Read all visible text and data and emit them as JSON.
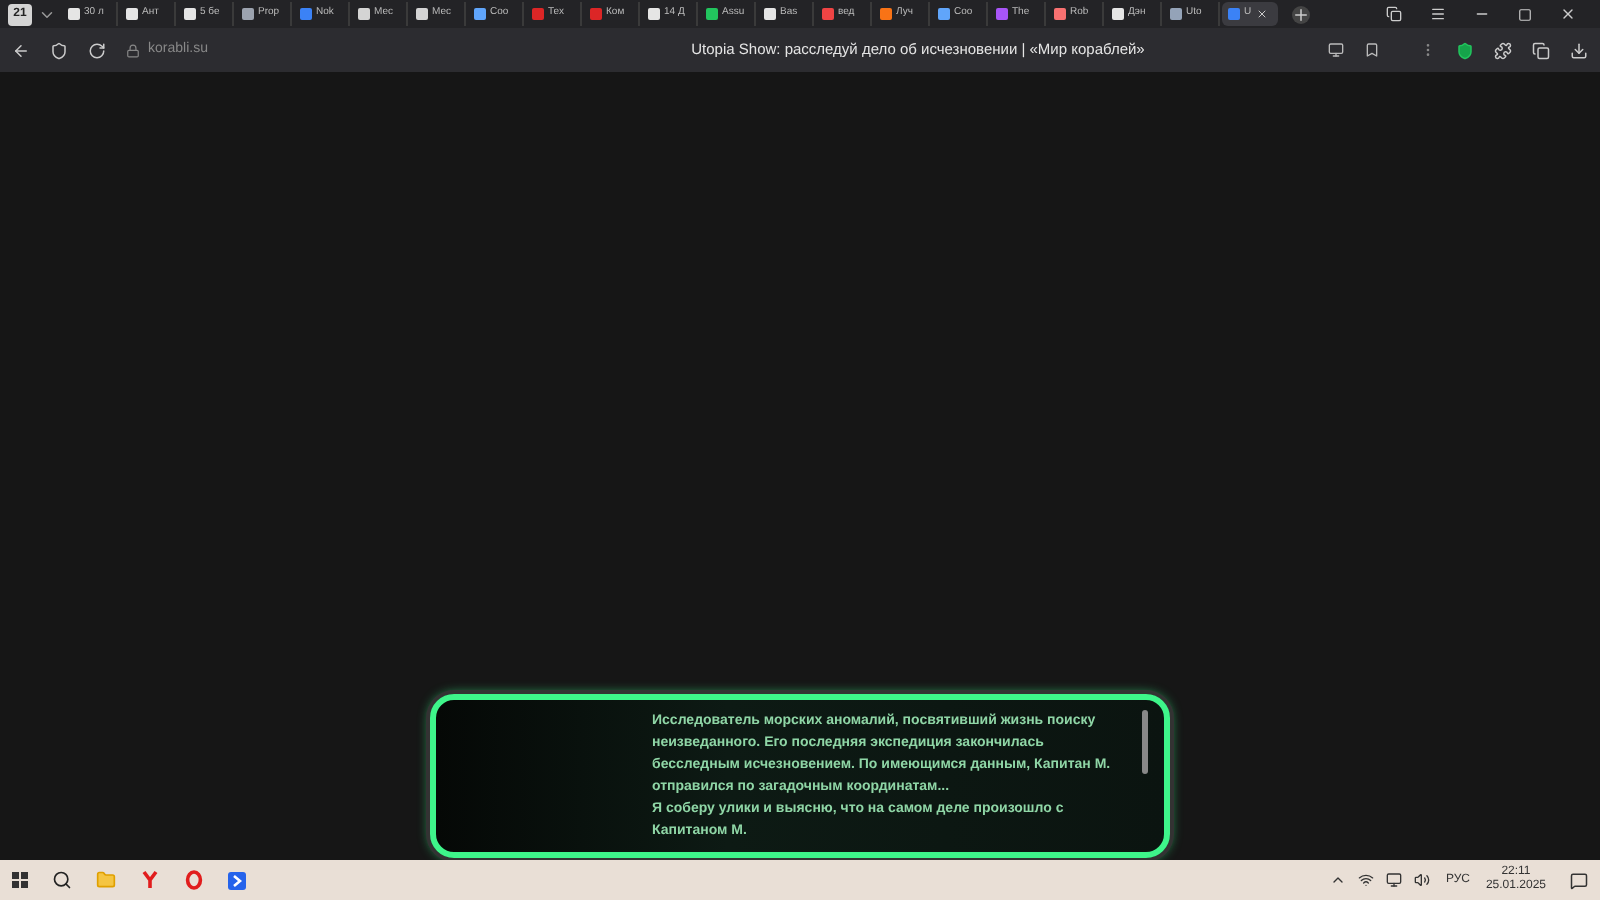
{
  "browser": {
    "profile_badge": "21",
    "tabs": [
      {
        "label": "30 л",
        "selected": false,
        "color": "#e5e5e5"
      },
      {
        "label": "Ант",
        "selected": false,
        "color": "#e5e5e5"
      },
      {
        "label": "5 бе",
        "selected": false,
        "color": "#e5e5e5"
      },
      {
        "label": "Prop",
        "selected": false,
        "color": "#9ca3af"
      },
      {
        "label": "Nok",
        "selected": false,
        "color": "#3b82f6"
      },
      {
        "label": "Мес",
        "selected": false,
        "color": "#d4d4d4"
      },
      {
        "label": "Мес",
        "selected": false,
        "color": "#d4d4d4"
      },
      {
        "label": "Coo",
        "selected": false,
        "color": "#60a5fa"
      },
      {
        "label": "Тех",
        "selected": false,
        "color": "#dc2626"
      },
      {
        "label": "Ком",
        "selected": false,
        "color": "#dc2626"
      },
      {
        "label": "14 Д",
        "selected": false,
        "color": "#e5e5e5"
      },
      {
        "label": "Assu",
        "selected": false,
        "color": "#22c55e"
      },
      {
        "label": "Bas",
        "selected": false,
        "color": "#e5e5e5"
      },
      {
        "label": "вед",
        "selected": false,
        "color": "#ef4444"
      },
      {
        "label": "Луч",
        "selected": false,
        "color": "#f97316"
      },
      {
        "label": "Coo",
        "selected": false,
        "color": "#60a5fa"
      },
      {
        "label": "The",
        "selected": false,
        "color": "#a855f7"
      },
      {
        "label": "Rob",
        "selected": false,
        "color": "#f87171"
      },
      {
        "label": "Дэн",
        "selected": false,
        "color": "#e5e5e5"
      },
      {
        "label": "Uto",
        "selected": false,
        "color": "#94a3b8"
      },
      {
        "label": "U",
        "selected": true,
        "color": "#3b82f6"
      }
    ],
    "address": "korabli.su",
    "page_title": "Utopia Show: расследуй дело об исчезновении | «Мир кораблей»"
  },
  "dialog": {
    "lines": [
      "Исследователь морских аномалий, посвятивший жизнь поиску неизведанного. Его последняя экспедиция закончилась бесследным исчезновением. По имеющимся данным, Капитан М. отправился по загадочным координатам...",
      "Я соберу улики и выясню, что на самом деле произошло с Капитаном М."
    ]
  },
  "taskbar": {
    "language": "РУС",
    "time": "22:11",
    "date": "25.01.2025"
  }
}
